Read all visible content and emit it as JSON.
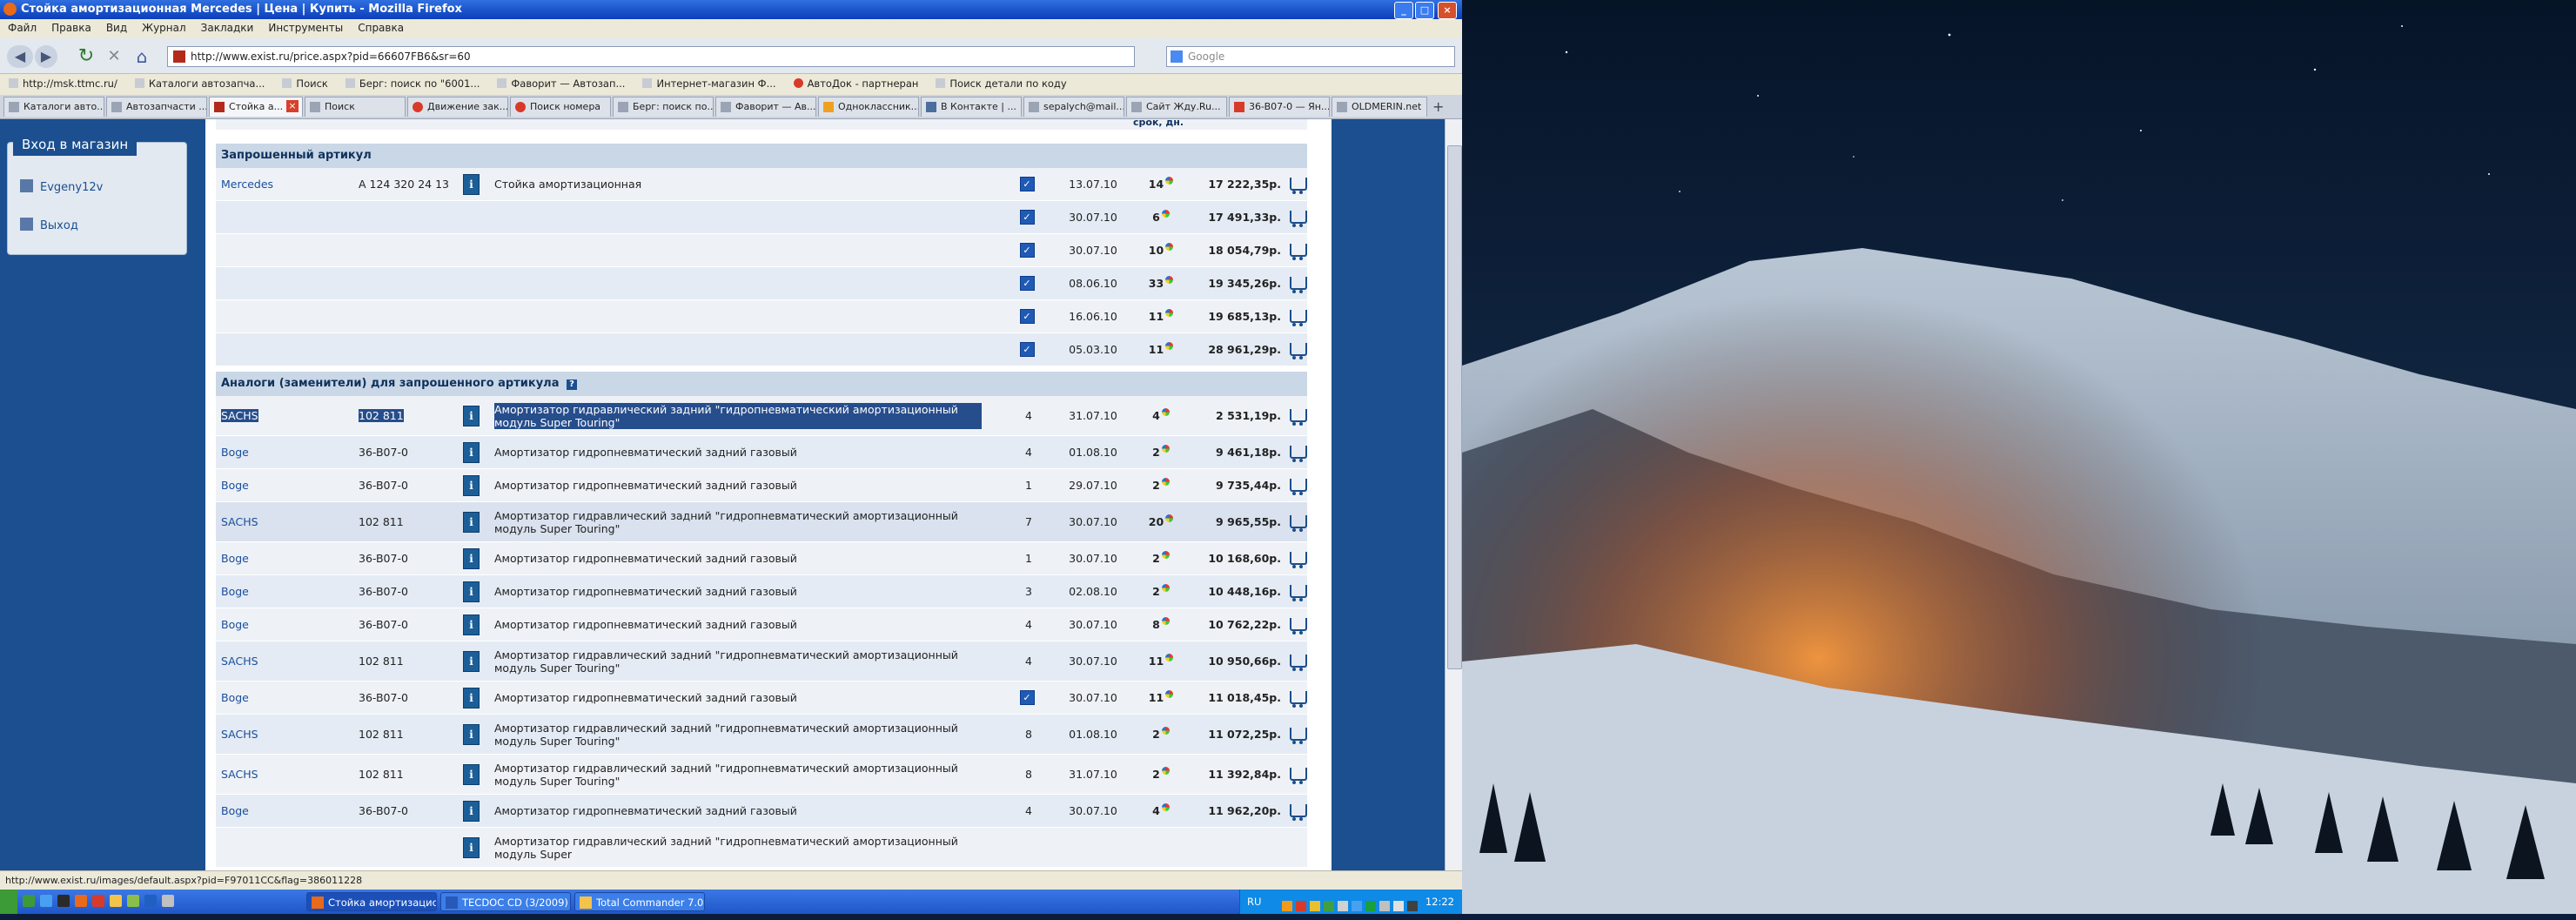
{
  "window": {
    "title": "Стойка амортизационная Mercedes | Цена | Купить - Mozilla Firefox",
    "controls": {
      "minimize": "_",
      "maximize": "□",
      "close": "×"
    }
  },
  "menu": [
    "Файл",
    "Правка",
    "Вид",
    "Журнал",
    "Закладки",
    "Инструменты",
    "Справка"
  ],
  "nav": {
    "back": "◀",
    "forward": "▶",
    "reload": "↻",
    "stop": "✕",
    "home": "⌂",
    "url": "http://www.exist.ru/price.aspx?pid=66607FB6&sr=60",
    "search_placeholder": "Google"
  },
  "bookmarks": [
    "http://msk.ttmc.ru/",
    "Каталоги автозапча...",
    "Поиск",
    "Берг: поиск по \"6001...",
    "Фаворит — Автозап...",
    "Интернет-магазин Ф...",
    "АвтоДок - партнеран",
    "Поиск детали по коду"
  ],
  "tabs": [
    {
      "label": "Каталоги авто...",
      "active": false
    },
    {
      "label": "Автозапчасти ...",
      "active": false
    },
    {
      "label": "Стойка а...",
      "active": true
    },
    {
      "label": "Поиск",
      "active": false
    },
    {
      "label": "Движение зак...",
      "active": false
    },
    {
      "label": "Поиск номера",
      "active": false
    },
    {
      "label": "Берг: поиск по...",
      "active": false
    },
    {
      "label": "Фаворит — Ав...",
      "active": false
    },
    {
      "label": "Одноклассник...",
      "active": false
    },
    {
      "label": "В Контакте | ...",
      "active": false
    },
    {
      "label": "sepalych@mail....",
      "active": false
    },
    {
      "label": "Сайт Жду.Ru...",
      "active": false
    },
    {
      "label": "36-B07-0 — Ян...",
      "active": false
    },
    {
      "label": "OLDMERIN.net",
      "active": false
    }
  ],
  "tab_close": "×",
  "new_tab": "+",
  "sidebar": {
    "login_title": "Вход в магазин",
    "user": "Evgeny12v",
    "logout": "Выход"
  },
  "column_header_fragment": "срок, дн.",
  "requested": {
    "header": "Запрошенный артикул",
    "brand": "Mercedes",
    "article": "A 124 320 24 13",
    "description": "Стойка амортизационная",
    "offers": [
      {
        "date": "13.07.10",
        "days": "14",
        "price": "17 222,35р."
      },
      {
        "date": "30.07.10",
        "days": "6",
        "price": "17 491,33р."
      },
      {
        "date": "30.07.10",
        "days": "10",
        "price": "18 054,79р."
      },
      {
        "date": "08.06.10",
        "days": "33",
        "price": "19 345,26р."
      },
      {
        "date": "16.06.10",
        "days": "11",
        "price": "19 685,13р."
      },
      {
        "date": "05.03.10",
        "days": "11",
        "price": "28 961,29р."
      }
    ]
  },
  "analogs": {
    "header": "Аналоги (заменители) для запрошенного артикула",
    "help": "?",
    "rows": [
      {
        "brand": "SACHS",
        "article": "102 811",
        "description": "Амортизатор гидравлический задний \"гидропневматический амортизационный модуль Super Touring\"",
        "qty": "4",
        "date": "31.07.10",
        "days": "4",
        "price": "2 531,19р."
      },
      {
        "brand": "Boge",
        "article": "36-B07-0",
        "description": "Амортизатор гидропневматический задний газовый",
        "qty": "4",
        "date": "01.08.10",
        "days": "2",
        "price": "9 461,18р."
      },
      {
        "brand": "Boge",
        "article": "36-B07-0",
        "description": "Амортизатор гидропневматический задний газовый",
        "qty": "1",
        "date": "29.07.10",
        "days": "2",
        "price": "9 735,44р."
      },
      {
        "brand": "SACHS",
        "article": "102 811",
        "description": "Амортизатор гидравлический задний \"гидропневматический амортизационный модуль Super Touring\"",
        "qty": "7",
        "date": "30.07.10",
        "days": "20",
        "price": "9 965,55р."
      },
      {
        "brand": "Boge",
        "article": "36-B07-0",
        "description": "Амортизатор гидропневматический задний газовый",
        "qty": "1",
        "date": "30.07.10",
        "days": "2",
        "price": "10 168,60р."
      },
      {
        "brand": "Boge",
        "article": "36-B07-0",
        "description": "Амортизатор гидропневматический задний газовый",
        "qty": "3",
        "date": "02.08.10",
        "days": "2",
        "price": "10 448,16р."
      },
      {
        "brand": "Boge",
        "article": "36-B07-0",
        "description": "Амортизатор гидропневматический задний газовый",
        "qty": "4",
        "date": "30.07.10",
        "days": "8",
        "price": "10 762,22р."
      },
      {
        "brand": "SACHS",
        "article": "102 811",
        "description": "Амортизатор гидравлический задний \"гидропневматический амортизационный модуль Super Touring\"",
        "qty": "4",
        "date": "30.07.10",
        "days": "11",
        "price": "10 950,66р."
      },
      {
        "brand": "Boge",
        "article": "36-B07-0",
        "description": "Амортизатор гидропневматический задний газовый",
        "qty": "",
        "date": "30.07.10",
        "days": "11",
        "price": "11 018,45р."
      },
      {
        "brand": "SACHS",
        "article": "102 811",
        "description": "Амортизатор гидравлический задний \"гидропневматический амортизационный модуль Super Touring\"",
        "qty": "8",
        "date": "01.08.10",
        "days": "2",
        "price": "11 072,25р."
      },
      {
        "brand": "SACHS",
        "article": "102 811",
        "description": "Амортизатор гидравлический задний \"гидропневматический амортизационный модуль Super Touring\"",
        "qty": "8",
        "date": "31.07.10",
        "days": "2",
        "price": "11 392,84р."
      },
      {
        "brand": "Boge",
        "article": "36-B07-0",
        "description": "Амортизатор гидропневматический задний газовый",
        "qty": "4",
        "date": "30.07.10",
        "days": "4",
        "price": "11 962,20р."
      },
      {
        "brand": "",
        "article": "",
        "description": "Амортизатор гидравлический задний \"гидропневматический амортизационный модуль Super",
        "qty": "",
        "date": "",
        "days": "",
        "price": ""
      }
    ]
  },
  "status_url": "http://www.exist.ru/images/default.aspx?pid=F97011CC&flag=386011228",
  "taskbar": {
    "items": [
      {
        "label": "Стойка амортизацион...",
        "active": true
      },
      {
        "label": "TECDOC CD (3/2009) ...",
        "active": false
      },
      {
        "label": "Total Commander 7.0...",
        "active": false
      }
    ],
    "lang": "RU",
    "clock": "12:22"
  },
  "colors": {
    "site_blue": "#1b4f8f",
    "link": "#1a4e9c",
    "xp_taskbar": "#245edb"
  }
}
